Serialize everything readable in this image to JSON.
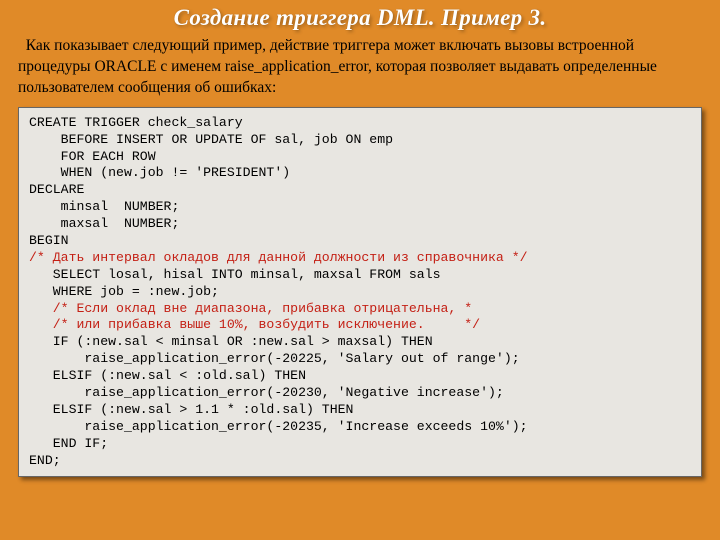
{
  "title": "Создание триггера DML. Пример 3.",
  "description": "  Как  показывает  следующий   пример,  действие  триггера   может включать   вызовы   встроенной   процедуры   ORACLE   с   именем raise_application_error, которая позволяет выдавать определенные пользователем сообщения об ошибках:",
  "code": {
    "l01": "CREATE TRIGGER check_salary",
    "l02": "    BEFORE INSERT OR UPDATE OF sal, job ON emp",
    "l03": "    FOR EACH ROW",
    "l04": "    WHEN (new.job != 'PRESIDENT')",
    "l05": "DECLARE",
    "l06": "    minsal  NUMBER;",
    "l07": "    maxsal  NUMBER;",
    "l08": "BEGIN",
    "l09": "/* Дать интервал окладов для данной должности из справочника */",
    "l10": "   SELECT losal, hisal INTO minsal, maxsal FROM sals",
    "l11": "   WHERE job = :new.job;",
    "l12": "   /* Если оклад вне диапазона, прибавка отрицательна, *",
    "l13": "   /* или прибавка выше 10%, возбудить исключение.     */",
    "l14": "   IF (:new.sal < minsal OR :new.sal > maxsal) THEN",
    "l15": "       raise_application_error(-20225, 'Salary out of range');",
    "l16": "   ELSIF (:new.sal < :old.sal) THEN",
    "l17": "       raise_application_error(-20230, 'Negative increase');",
    "l18": "   ELSIF (:new.sal > 1.1 * :old.sal) THEN",
    "l19": "       raise_application_error(-20235, 'Increase exceeds 10%');",
    "l20": "   END IF;",
    "l21": "END;"
  }
}
